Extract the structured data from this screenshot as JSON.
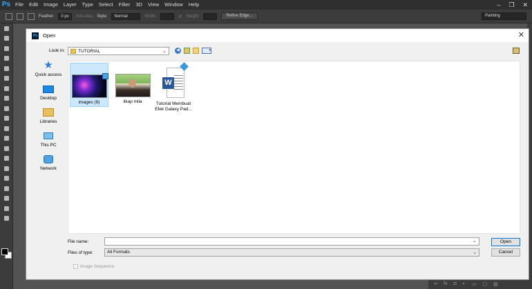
{
  "app": {
    "logo": "Ps",
    "menu": [
      "File",
      "Edit",
      "Image",
      "Layer",
      "Type",
      "Select",
      "Filter",
      "3D",
      "View",
      "Window",
      "Help"
    ],
    "window_controls": [
      "–",
      "❐",
      "✕"
    ]
  },
  "options_bar": {
    "feather_label": "Feather:",
    "feather_value": "0 px",
    "antialias_label": "Anti-alias",
    "style_label": "Style:",
    "style_value": "Normal",
    "width_label": "Width:",
    "height_label": "Height:",
    "refine_edge_label": "Refine Edge...",
    "workspace_value": "Painting"
  },
  "dialog": {
    "title": "Open",
    "ps_icon": "Ps",
    "close_icon": "✕",
    "look_in_label": "Look in:",
    "look_in_value": "TUTORIAL",
    "places": [
      {
        "label": "Quick access",
        "icon": "star-icon"
      },
      {
        "label": "Desktop",
        "icon": "desktop-icon"
      },
      {
        "label": "Libraries",
        "icon": "libraries-icon"
      },
      {
        "label": "This PC",
        "icon": "computer-icon"
      },
      {
        "label": "Network",
        "icon": "network-icon"
      }
    ],
    "files": [
      {
        "name": "images (9)",
        "selected": true
      },
      {
        "name": "likap mila",
        "selected": false
      },
      {
        "name": "Tutorial Membuat Efek Galaxy Pad...",
        "selected": false
      }
    ],
    "file_name_label": "File name:",
    "file_name_value": "",
    "file_type_label": "Files of type:",
    "file_type_value": "All Formats",
    "open_label": "Open",
    "cancel_label": "Cancel",
    "image_sequence_label": "Image Sequence",
    "image_sequence_checked": false
  }
}
